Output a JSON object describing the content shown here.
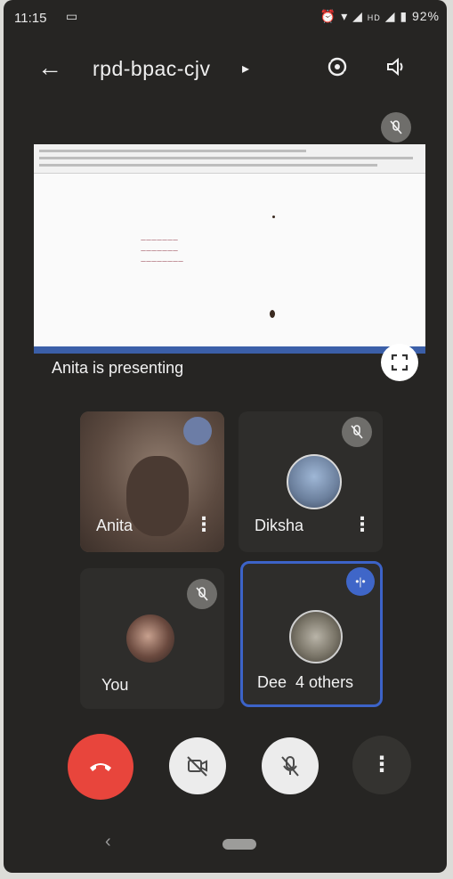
{
  "status_bar": {
    "time": "11:15",
    "indicators": "HD",
    "battery": "92%"
  },
  "header": {
    "meeting_code": "rpd-bpac-cjv"
  },
  "presentation": {
    "label": "Anita is presenting"
  },
  "participants": [
    {
      "name": "Anita"
    },
    {
      "name": "Diksha"
    },
    {
      "name": "You"
    },
    {
      "name": "Dee  4 others"
    }
  ],
  "colors": {
    "background": "#262523",
    "end_call": "#e8453c",
    "active_outline": "#3c63c8",
    "speaking_badge": "#3f66c8"
  },
  "icons": {
    "back": "arrow-left",
    "switch_camera": "camera-switch",
    "speaker": "volume",
    "mic_off": "mic-off",
    "fullscreen": "fullscreen",
    "more": "more-vertical",
    "end_call": "phone-hangup",
    "camera_off": "camera-off"
  }
}
